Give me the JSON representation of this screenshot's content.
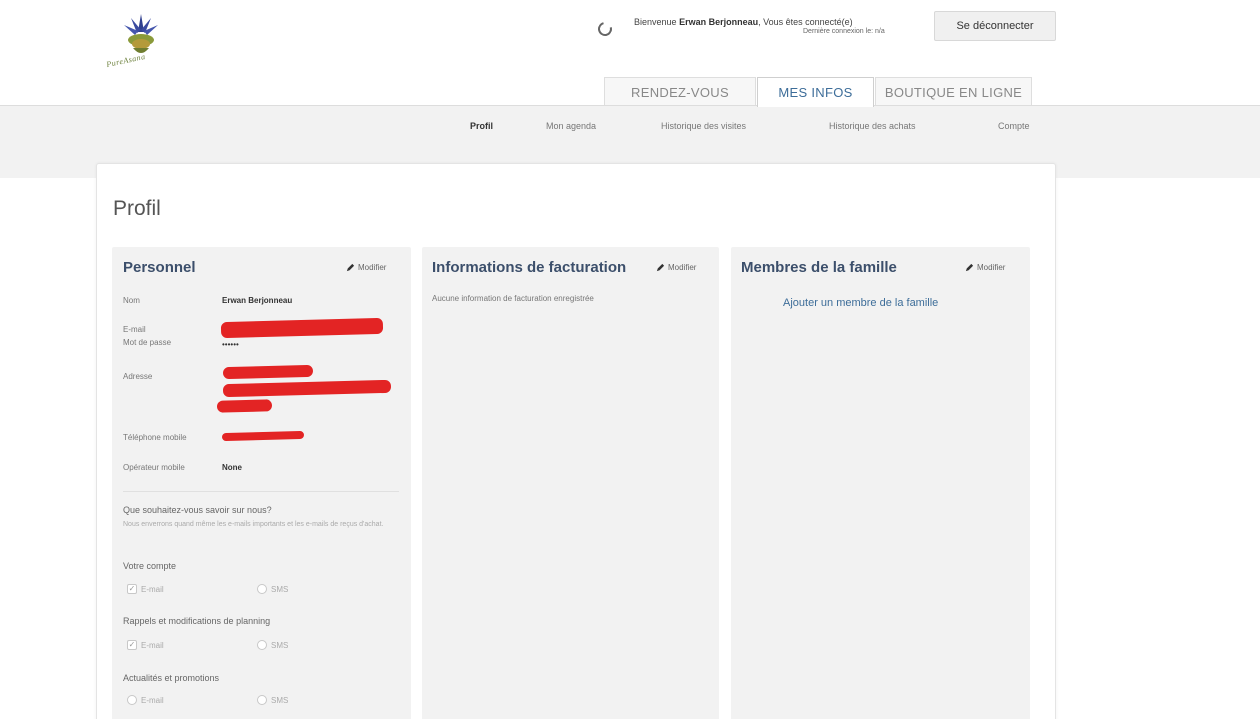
{
  "logo": {
    "text": "PureAsana",
    "icon": "lotus-logo"
  },
  "header": {
    "welcome_prefix": "Bienvenue",
    "user_name": "Erwan Berjonneau",
    "welcome_suffix": ", Vous êtes connecté(e)",
    "last_connection": "Dernière connexion le: n/a",
    "logout_label": "Se déconnecter",
    "spinner_icon": "spinner-icon"
  },
  "main_tabs": [
    {
      "label": "RENDEZ-VOUS",
      "active": false
    },
    {
      "label": "MES INFOS",
      "active": true
    },
    {
      "label": "BOUTIQUE EN LIGNE",
      "active": false
    }
  ],
  "sub_nav": [
    {
      "label": "Profil",
      "active": true
    },
    {
      "label": "Mon agenda",
      "active": false
    },
    {
      "label": "Historique des visites",
      "active": false
    },
    {
      "label": "Historique des achats",
      "active": false
    },
    {
      "label": "Compte",
      "active": false
    }
  ],
  "page": {
    "title": "Profil"
  },
  "personal": {
    "title": "Personnel",
    "edit_label": "Modifier",
    "fields": {
      "name_label": "Nom",
      "name_value": "Erwan Berjonneau",
      "email_label": "E-mail",
      "password_label": "Mot de passe",
      "password_value": "••••••",
      "address_label": "Adresse",
      "phone_label": "Téléphone mobile",
      "carrier_label": "Opérateur mobile",
      "carrier_value": "None"
    },
    "notifications": {
      "prompt": "Que souhaitez-vous savoir sur nous?",
      "hint": "Nous enverrons quand même les e-mails importants et les e-mails de reçus d'achat.",
      "groups": [
        {
          "title": "Votre compte",
          "email_label": "E-mail",
          "sms_label": "SMS",
          "email_checked": true,
          "sms_checked": false
        },
        {
          "title": "Rappels et modifications de planning",
          "email_label": "E-mail",
          "sms_label": "SMS",
          "email_checked": true,
          "sms_checked": false
        },
        {
          "title": "Actualités et promotions",
          "email_label": "E-mail",
          "sms_label": "SMS",
          "email_checked": false,
          "sms_checked": false
        }
      ]
    }
  },
  "billing": {
    "title": "Informations de facturation",
    "edit_label": "Modifier",
    "empty_text": "Aucune information de facturation enregistrée"
  },
  "family": {
    "title": "Membres de la famille",
    "edit_label": "Modifier",
    "add_link": "Ajouter un membre de la famille"
  },
  "colors": {
    "accent_blue": "#3d6d99",
    "panel_title": "#3c4f6b",
    "panel_bg": "#f2f2f2",
    "redaction_red": "#e32424"
  }
}
